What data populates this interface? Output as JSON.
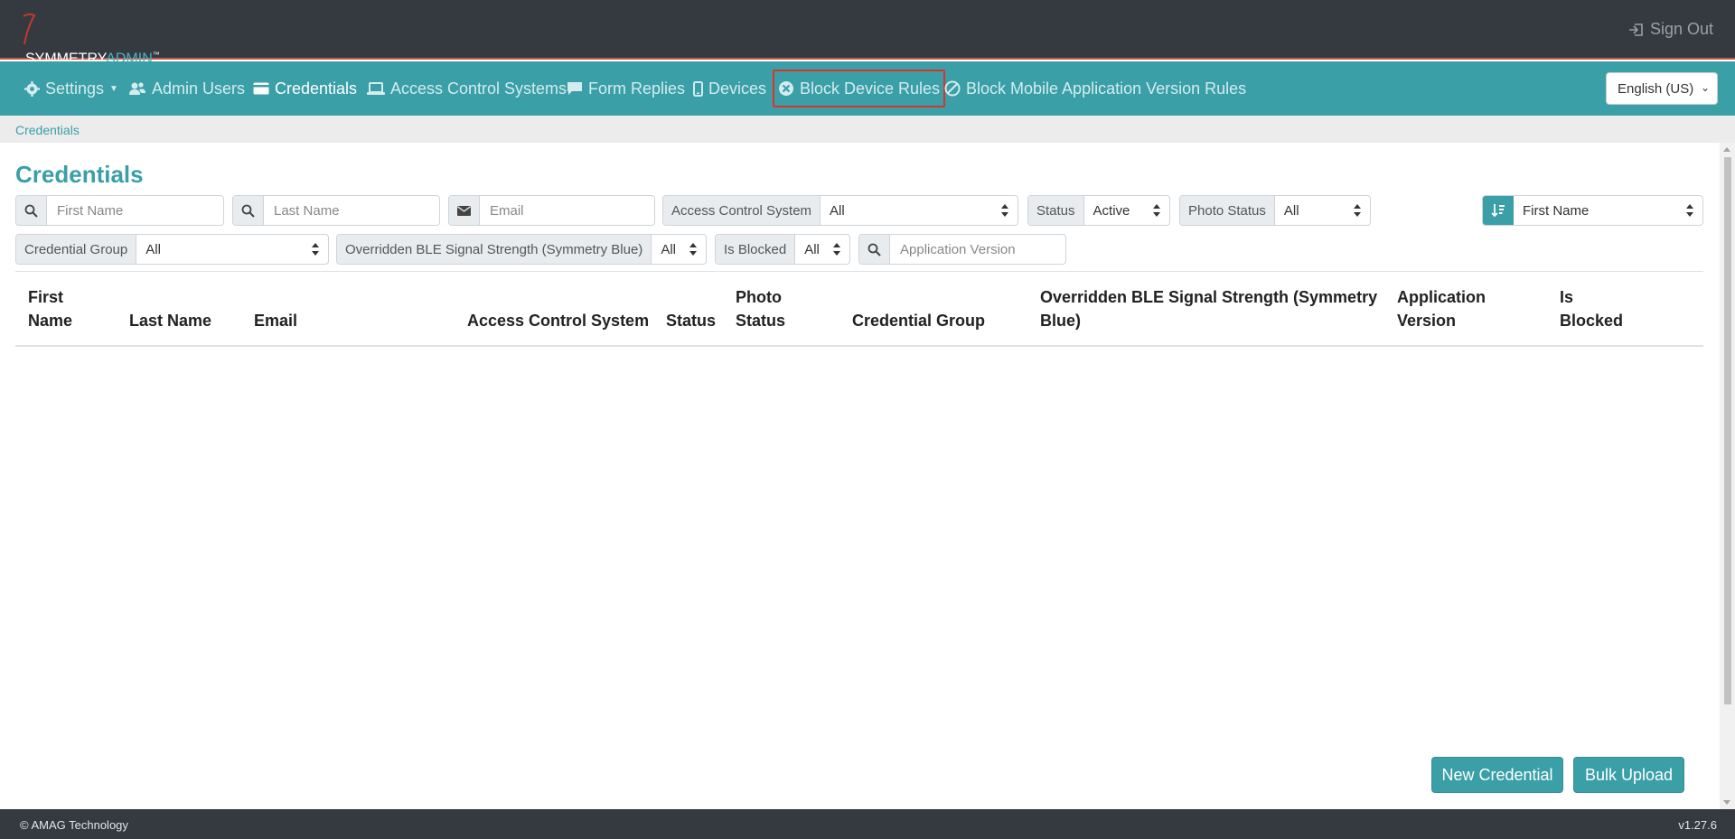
{
  "header": {
    "logo_main": "SYMMETRY",
    "logo_accent": "ADMIN",
    "logo_mark": "™",
    "signout_label": "Sign Out"
  },
  "nav": {
    "items": [
      {
        "label": "Settings",
        "icon": "gear-icon"
      },
      {
        "label": "Admin Users",
        "icon": "users-icon"
      },
      {
        "label": "Credentials",
        "icon": "id-card-icon"
      },
      {
        "label": "Access Control Systems",
        "icon": "laptop-icon"
      },
      {
        "label": "Form Replies",
        "icon": "comment-icon"
      },
      {
        "label": "Devices",
        "icon": "mobile-icon"
      },
      {
        "label": "Block Device Rules",
        "icon": "times-circle-icon"
      },
      {
        "label": "Block Mobile Application Version Rules",
        "icon": "ban-icon"
      }
    ],
    "language": "English (US)"
  },
  "breadcrumb": "Credentials",
  "page_title": "Credentials",
  "filters": {
    "first_name_placeholder": "First Name",
    "last_name_placeholder": "Last Name",
    "email_placeholder": "Email",
    "access_control_label": "Access Control System",
    "access_control_value": "All",
    "status_label": "Status",
    "status_value": "Active",
    "photo_status_label": "Photo Status",
    "photo_status_value": "All",
    "sort_value": "First Name",
    "credential_group_label": "Credential Group",
    "credential_group_value": "All",
    "ble_label": "Overridden BLE Signal Strength (Symmetry Blue)",
    "ble_value": "All",
    "is_blocked_label": "Is Blocked",
    "is_blocked_value": "All",
    "app_version_placeholder": "Application Version"
  },
  "table": {
    "columns": [
      {
        "line1": "First",
        "line2": "Name"
      },
      {
        "line1": "",
        "line2": "Last Name"
      },
      {
        "line1": "",
        "line2": "Email"
      },
      {
        "line1": "",
        "line2": "Access Control System"
      },
      {
        "line1": "",
        "line2": "Status"
      },
      {
        "line1": "Photo",
        "line2": "Status"
      },
      {
        "line1": "",
        "line2": "Credential Group"
      },
      {
        "line1": "Overridden BLE Signal Strength (Symmetry",
        "line2": "Blue)"
      },
      {
        "line1": "Application",
        "line2": "Version"
      },
      {
        "line1": "Is",
        "line2": "Blocked"
      }
    ]
  },
  "actions": {
    "new_credential": "New Credential",
    "bulk_upload": "Bulk Upload"
  },
  "footer": {
    "copyright": "© AMAG Technology",
    "version": "v1.27.6"
  }
}
